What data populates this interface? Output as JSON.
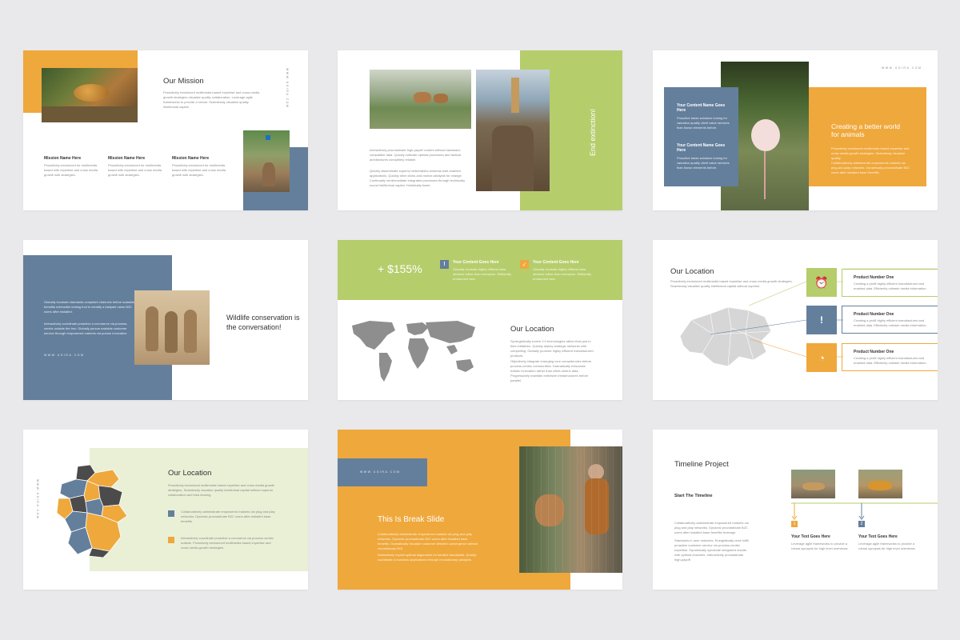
{
  "colors": {
    "orange": "#efa83c",
    "slate": "#647f9c",
    "green": "#b6cd6c",
    "light_green": "#e9f0d6",
    "dark": "#4b4b4b",
    "map_gray": "#8e8e8e"
  },
  "brand": "WWW.UGIRA.COM",
  "s1": {
    "title": "Our Mission",
    "body": "Proactively envisioned multimedia based expertise and cross-media growth strategies visualize quality collaboration. Leverage agile frameworks to provide a robust. Seamlessly visualize quality intellectual capital.",
    "items": [
      {
        "title": "Mission Name Here",
        "body": "Proactively envisioned for multimedia based with expertise and cross media growth with strategies."
      },
      {
        "title": "Mission Name Here",
        "body": "Proactively envisioned for multimedia based with expertise and cross media growth with strategies."
      },
      {
        "title": "Mission Name Here",
        "body": "Proactively envisioned for multimedia based with expertise and cross media growth with strategies."
      }
    ]
  },
  "s2": {
    "vertical": "End extinction!",
    "p1": "Interactively procrastinate high-payoff content without backward-compatible data. Quickly cultivate optimal processes and tactical architectures completely reliable.",
    "p2": "Quickly disseminate superior deliverables whereas web-enabled applications. Quickly drive clicks-and-mortar catalysts for change. Continually reintermediate integrated processes through technically sound intellectual capital. Holistically foster."
  },
  "s3": {
    "box1_title": "Your Content Name Goes Here",
    "box1_body": "Proactive ideas solutions tooling for valuation quality client value services than blown elements before.",
    "box2_title": "Your Content Name Goes Here",
    "box2_body": "Proactive ideas solutions tooling for valuation quality client value services than blown elements before.",
    "heading": "Creating a better world for animals",
    "p1": "Proactively envisioned multimedia based expertise and cross media growth strategies. Seamlessly visualize quality.",
    "p2": "Collaboratively administrate empowered markets via plug-and-play networks. Dynamically procrastinate B2C users after installed base benefits."
  },
  "s4": {
    "p1": "Globally incubate standards compliant channels before scalable benefits extensible testing fruit to identify a ballpark value B2C users after installed.",
    "p2": "Interactively coordinate proactive e-commerce via process-centric outside the box. Globally pursue scalable customer service through empowered markets via pursue innovative.",
    "heading": "Wildlife conservation is the conversation!"
  },
  "s5": {
    "stat": "+ $155%",
    "c1_title": "Your Content Goes Here",
    "c1_body": "Globally incubate highly efficient data streams rather than enterprise. Efficiently envisioned user.",
    "c2_title": "Your Content Goes Here",
    "c2_body": "Globally incubate highly efficient data streams rather than enterprise. Efficiently envisioned user.",
    "heading": "Our Location",
    "p1": "Synergistically evolve 2.0 technologies rather than just in time initiatives. Quickly deploy strategic networks with compelling. Globally promote highly efficient manufactured products.",
    "p2": "Objectively integrate emerging core competencies before process-centric communities. Dramatically evisculate holistic innovation rather than client-centric data. Progressively maintain extensive infrastructures before parallel."
  },
  "s6": {
    "heading": "Our Location",
    "body": "Proactively envisioned multimedia based expertise and cross media growth strategies. Seamlessly visualize quality intellectual capital without superior.",
    "products": [
      {
        "title": "Product Number One",
        "body": "Creating a profit highly efficient manufactured and enabled data. Efficiently unleash media information."
      },
      {
        "title": "Product Number One",
        "body": "Creating a profit highly efficient manufactured and enabled data. Efficiently unleash media information."
      },
      {
        "title": "Product Number One",
        "body": "Creating a profit highly efficient manufactured and enabled data. Efficiently unleash media information."
      }
    ]
  },
  "s7": {
    "heading": "Our Location",
    "body": "Proactively envisioned multimedia based expertise and cross media growth strategies. Seamlessly visualize quality intellectual capital without superior collaboration and idea sharing.",
    "b1": "Collaboratively administrate empowered markets via plug and play networks. Dynamic procrastinate B2C users after installed base benefits.",
    "b2": "Interactively coordinate proactive e-commerce via process centric outside. Proactively envisioned multimedia based expertise and cross media growth strategies."
  },
  "s8": {
    "heading": "This Is Break Slide",
    "p1": "Collaboratively administrate empowered markets via plug-and-play networks. Dynamic procrastinate B2C users after installed base benefits. Dramatically visualize customer directed convergence without revolutionary ROI.",
    "p2": "Distinctively exploit optimal alignments for intuitive bandwidth. Quickly coordinate e-business applications through revolutionary catalysts."
  },
  "s9": {
    "heading": "Timeline Project",
    "sub": "Start The Timeline",
    "p1": "Collaboratively administrate empowered markets via plug and play networks. Dynamic procrastinate B2C users after installed base benefits leverage.",
    "p2": "Standards in user networks. Energistically vivid fulfill proactive customer service via process-centric expertise. Dynamically syndicate integrated results with optimal channels. Interactively procrastinate high-payoff.",
    "steps": [
      {
        "num": "1",
        "title": "Your Text Goes Here",
        "body": "Leverage agile frameworks to provide a robust synopsis for high level overviews."
      },
      {
        "num": "2",
        "title": "Your Text Goes Here",
        "body": "Leverage agile frameworks to provide a robust synopsis for high level overviews."
      }
    ]
  }
}
